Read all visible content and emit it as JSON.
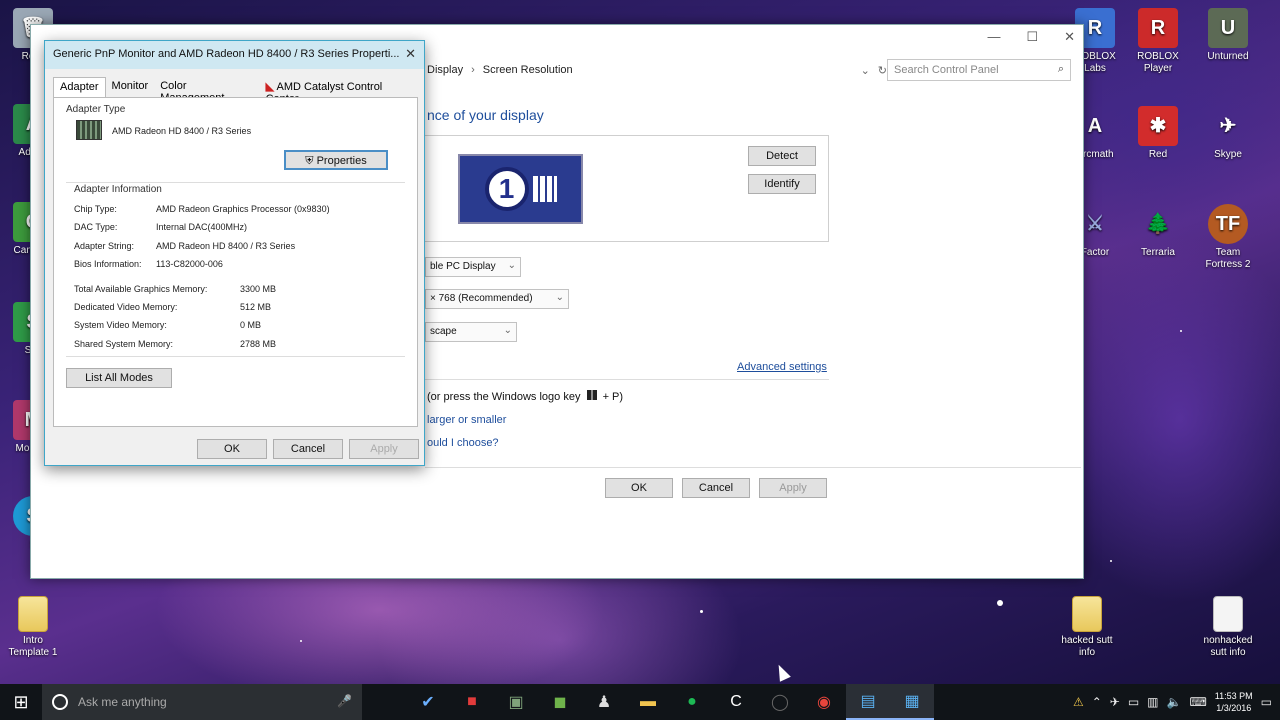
{
  "desktop": {
    "left_icons": [
      {
        "label": "Recy",
        "icon": "recycle-bin-icon"
      },
      {
        "label": "Adobe",
        "icon": "app-icon"
      },
      {
        "label": "Cam Stu",
        "icon": "camtasia-icon"
      },
      {
        "label": "Sky",
        "icon": "app-icon"
      },
      {
        "label": "Mo Live",
        "icon": "app-icon"
      },
      {
        "label": "S",
        "icon": "app-icon"
      }
    ],
    "right_icons": [
      {
        "label": "ROBLOX\nLabs",
        "icon": "roblox-icon"
      },
      {
        "label": "ROBLOX\nPlayer",
        "icon": "roblox-player-icon"
      },
      {
        "label": "Unturned",
        "icon": "unturned-icon"
      },
      {
        "label": "Arcmath",
        "icon": "app-icon"
      },
      {
        "label": "Red",
        "icon": "app-icon"
      },
      {
        "label": "Skype",
        "icon": "skype-icon"
      },
      {
        "label": "Factor",
        "icon": "app-icon"
      },
      {
        "label": "Terraria",
        "icon": "terraria-icon"
      },
      {
        "label": "Team\nFortress 2",
        "icon": "tf2-icon"
      }
    ],
    "bottom_icons": [
      {
        "label": "Intro\nTemplate 1",
        "icon": "folder-icon"
      },
      {
        "label": "hacked sutt\ninfo",
        "icon": "folder-icon"
      },
      {
        "label": "nonhacked\nsutt info",
        "icon": "file-icon"
      }
    ]
  },
  "main_window": {
    "breadcrumb": [
      "Display",
      "Screen Resolution"
    ],
    "search_placeholder": "Search Control Panel",
    "heading": "nce of your display",
    "detect_label": "Detect",
    "identify_label": "Identify",
    "display_number": "1",
    "display_dropdown": "ble PC Display",
    "resolution_dropdown": "× 768 (Recommended)",
    "orientation_dropdown": "scape",
    "advanced_settings": "Advanced settings",
    "project_text": "(or press the Windows logo key",
    "project_suffix": "+ P)",
    "bigger_text_link": "larger or smaller",
    "choose_link": "ould I choose?",
    "ok_label": "OK",
    "cancel_label": "Cancel",
    "apply_label": "Apply"
  },
  "props_dialog": {
    "title": "Generic PnP Monitor and AMD Radeon HD 8400 / R3 Series Properti...",
    "tabs": [
      "Adapter",
      "Monitor",
      "Color Management",
      "AMD Catalyst Control Center"
    ],
    "adapter_type_label": "Adapter Type",
    "adapter_type_value": "AMD Radeon HD 8400 / R3 Series",
    "properties_button": "Properties",
    "adapter_info_label": "Adapter Information",
    "info_rows": [
      {
        "label": "Chip Type:",
        "value": "AMD Radeon Graphics Processor (0x9830)"
      },
      {
        "label": "DAC Type:",
        "value": "Internal DAC(400MHz)"
      },
      {
        "label": "Adapter String:",
        "value": "AMD Radeon HD 8400 / R3 Series"
      },
      {
        "label": "Bios Information:",
        "value": "113-C82000-006"
      }
    ],
    "memory_rows": [
      {
        "label": "Total Available Graphics Memory:",
        "value": "3300 MB"
      },
      {
        "label": "Dedicated Video Memory:",
        "value": "512 MB"
      },
      {
        "label": "System Video Memory:",
        "value": "0 MB"
      },
      {
        "label": "Shared System Memory:",
        "value": "2788 MB"
      }
    ],
    "list_modes_button": "List All Modes",
    "ok_label": "OK",
    "cancel_label": "Cancel",
    "apply_label": "Apply"
  },
  "taskbar": {
    "search_placeholder": "Ask me anything",
    "time": "11:53 PM",
    "date": "1/3/2016"
  }
}
